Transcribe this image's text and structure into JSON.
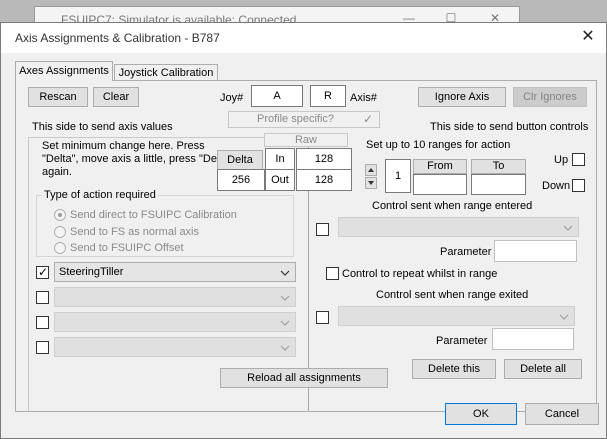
{
  "background_window": {
    "title": "FSUIPC7: Simulator is available: Connected"
  },
  "dialog": {
    "title": "Axis Assignments & Calibration - B787"
  },
  "tabs": [
    {
      "label": "Axes Assignments",
      "active": true
    },
    {
      "label": "Joystick Calibration",
      "active": false
    }
  ],
  "top": {
    "rescan": "Rescan",
    "clear": "Clear",
    "joy_label": "Joy#",
    "joy_value": "A",
    "axis_value": "R",
    "axis_label": "Axis#",
    "ignore_axis": "Ignore Axis",
    "clr_ignores": "Clr Ignores",
    "profile_specific": "Profile specific?",
    "profile_checked": true,
    "left_heading": "This side to send axis values",
    "right_heading": "This side to send button controls"
  },
  "delta": {
    "instruction": "Set minimum change  here.  Press \"Delta\", move axis a little,  press \"Delta\" again.",
    "delta_button": "Delta",
    "delta_value": "256",
    "raw_label": "Raw",
    "in_label": "In",
    "in_value": "128",
    "out_label": "Out",
    "out_value": "128"
  },
  "action_group": {
    "legend": "Type of action required",
    "options": [
      {
        "label": "Send direct to FSUIPC Calibration",
        "selected": true
      },
      {
        "label": "Send to FS as normal axis",
        "selected": false
      },
      {
        "label": "Send to FSUIPC Offset",
        "selected": false
      }
    ]
  },
  "axis_rows": [
    {
      "checked": true,
      "value": "SteeringTiller",
      "enabled": true
    },
    {
      "checked": false,
      "value": "",
      "enabled": false
    },
    {
      "checked": false,
      "value": "",
      "enabled": false
    },
    {
      "checked": false,
      "value": "",
      "enabled": false
    }
  ],
  "ranges": {
    "heading": "Set up to 10 ranges for action",
    "range_index": "1",
    "from_label": "From",
    "to_label": "To",
    "up_label": "Up",
    "down_label": "Down",
    "entered_heading": "Control sent when range entered",
    "parameter_label": "Parameter",
    "repeat_label": "Control to repeat whilst in range",
    "exited_heading": "Control sent when range exited",
    "delete_this": "Delete this",
    "delete_all": "Delete all"
  },
  "bottom": {
    "reload": "Reload all assignments",
    "ok": "OK",
    "cancel": "Cancel"
  }
}
